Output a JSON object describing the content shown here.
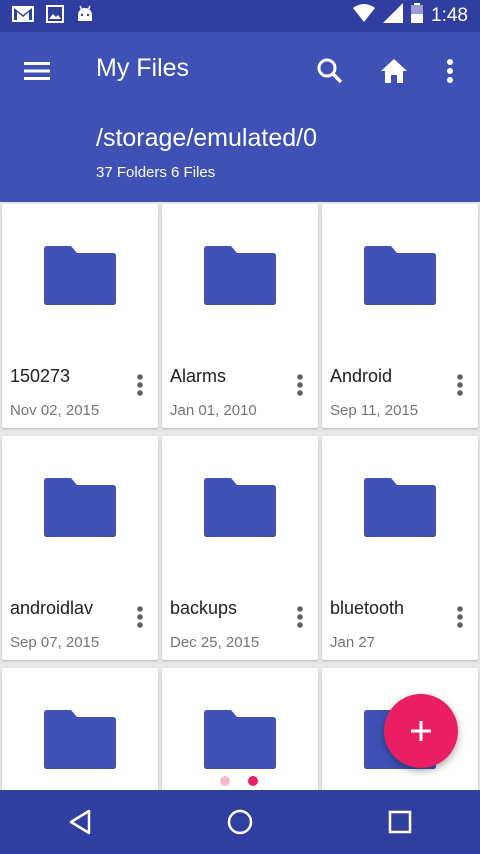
{
  "statusbar": {
    "time": "1:48"
  },
  "appbar": {
    "title": "My Files",
    "path": "/storage/emulated/0",
    "counts": "37 Folders 6 Files"
  },
  "items": [
    {
      "name": "150273",
      "date": "Nov 02, 2015"
    },
    {
      "name": "Alarms",
      "date": "Jan 01, 2010"
    },
    {
      "name": "Android",
      "date": "Sep 11, 2015"
    },
    {
      "name": "androidlav",
      "date": "Sep 07, 2015"
    },
    {
      "name": "backups",
      "date": "Dec 25, 2015"
    },
    {
      "name": "bluetooth",
      "date": "Jan 27"
    },
    {
      "name": "",
      "date": ""
    },
    {
      "name": "",
      "date": ""
    },
    {
      "name": "",
      "date": ""
    }
  ],
  "page_indicator": {
    "pages": 2,
    "active": 2
  },
  "colors": {
    "primary": "#3f51b5",
    "primary_dark": "#303f9f",
    "accent": "#e91e63",
    "folder": "#3f51b5",
    "dot_inactive": "#f8bbd0"
  },
  "icons": {
    "status_left": [
      "gmail-icon",
      "image-icon",
      "android-icon"
    ],
    "status_right": [
      "wifi-icon",
      "signal-icon",
      "battery-icon"
    ],
    "appbar": [
      "menu-icon",
      "search-icon",
      "home-icon",
      "more-vert-icon"
    ],
    "fab": "add-icon",
    "nav": [
      "back-icon",
      "home-circle-icon",
      "recents-icon"
    ]
  }
}
